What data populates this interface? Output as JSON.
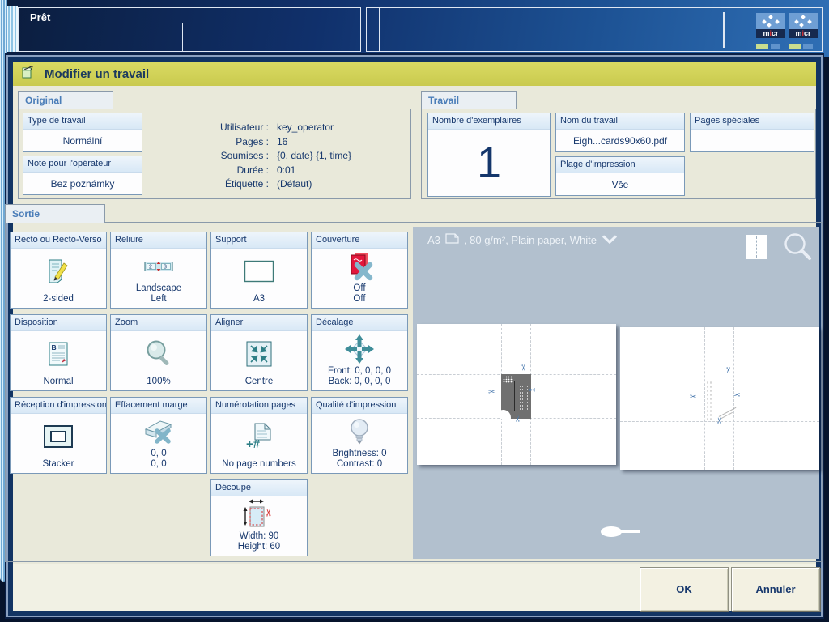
{
  "top_bar": {
    "status": "Prêt",
    "tray_icons": [
      {
        "parts": [
          "m",
          "i",
          "cr"
        ]
      },
      {
        "parts": [
          "m",
          "i",
          "cr"
        ]
      }
    ]
  },
  "dialog": {
    "title": "Modifier un travail",
    "original": {
      "tab": "Original",
      "type_tile": {
        "label": "Type de travail",
        "value": "Normální"
      },
      "note_tile": {
        "label": "Note pour l'opérateur",
        "value": "Bez poznámky"
      },
      "info": [
        {
          "label": "Utilisateur :",
          "value": "key_operator"
        },
        {
          "label": "Pages :",
          "value": "16"
        },
        {
          "label": "Soumises :",
          "value": "{0, date} {1, time}"
        },
        {
          "label": "Durée :",
          "value": "0:01"
        },
        {
          "label": "Étiquette :",
          "value": "(Défaut)"
        }
      ]
    },
    "travail": {
      "tab": "Travail",
      "copies": {
        "label": "Nombre d'exemplaires",
        "value": "1"
      },
      "job_name": {
        "label": "Nom du travail",
        "value": "Eigh...cards90x60.pdf"
      },
      "range": {
        "label": "Plage d'impression",
        "value": "Vše"
      },
      "special_pages": {
        "label": "Pages spéciales",
        "value": ""
      }
    },
    "sortie": {
      "tab": "Sortie",
      "tiles": [
        {
          "label": "Recto ou Recto-Verso",
          "lines": [
            "2-sided"
          ]
        },
        {
          "label": "Reliure",
          "lines": [
            "Landscape",
            "Left"
          ]
        },
        {
          "label": "Support",
          "lines": [
            "A3"
          ]
        },
        {
          "label": "Couverture",
          "lines": [
            "Off",
            "Off"
          ]
        },
        {
          "label": "Disposition",
          "lines": [
            "Normal"
          ]
        },
        {
          "label": "Zoom",
          "lines": [
            "100%"
          ]
        },
        {
          "label": "Aligner",
          "lines": [
            "Centre"
          ]
        },
        {
          "label": "Décalage",
          "lines": [
            "Front: 0, 0, 0, 0",
            "Back: 0, 0, 0, 0"
          ]
        },
        {
          "label": "Réception d'impression",
          "lines": [
            "Stacker"
          ]
        },
        {
          "label": "Effacement marge",
          "lines": [
            "0, 0",
            "0, 0"
          ]
        },
        {
          "label": "Numérotation pages",
          "lines": [
            "No page numbers"
          ]
        },
        {
          "label": "Qualité d'impression",
          "lines": [
            "Brightness: 0",
            "Contrast: 0"
          ]
        },
        {
          "label": "Découpe",
          "lines": [
            "Width: 90",
            "Height: 60"
          ]
        }
      ]
    },
    "preview": {
      "media_name": "A3",
      "media_details": ", 80 g/m², Plain paper, White"
    },
    "footer": {
      "ok": "OK",
      "cancel": "Annuler"
    }
  },
  "colors": {
    "topbar_gradient_start": "#0b1d3d",
    "topbar_gradient_end": "#2f6fb5",
    "title_bar": "#d3d456",
    "content_bg": "#e9e9da",
    "tile_header": "#ddeaf7",
    "tile_border": "#7a99b8",
    "navy_text": "#17386d",
    "tab_text": "#4a7db8",
    "preview_bg": "#b2c0ce",
    "footer_bg": "#f1f1e4",
    "tray_bar_green": "#c9dd8f",
    "tray_bar_blue": "#5f93cc"
  }
}
